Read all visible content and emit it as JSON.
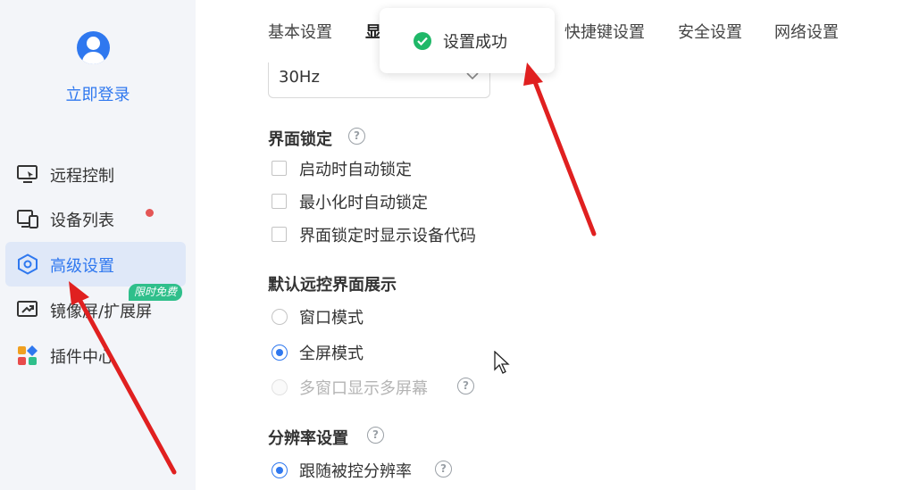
{
  "sidebar": {
    "login_label": "立即登录",
    "items": [
      {
        "label": "远程控制",
        "icon": "remote-desktop-icon"
      },
      {
        "label": "设备列表",
        "icon": "devices-icon"
      },
      {
        "label": "高级设置",
        "icon": "hexagon-settings-icon",
        "active": true
      },
      {
        "label": "镜像屏/扩展屏",
        "icon": "mirror-screen-icon"
      },
      {
        "label": "插件中心",
        "icon": "plugin-grid-icon"
      }
    ],
    "promo_badge": "限时免费"
  },
  "tabs": [
    "基本设置",
    "显",
    "快捷键设置",
    "安全设置",
    "网络设置"
  ],
  "refresh_select": {
    "value": "30Hz"
  },
  "lock_section": {
    "title": "界面锁定",
    "options": [
      "启动时自动锁定",
      "最小化时自动锁定",
      "界面锁定时显示设备代码"
    ]
  },
  "display_section": {
    "title": "默认远控界面展示",
    "options": [
      {
        "label": "窗口模式",
        "checked": false
      },
      {
        "label": "全屏模式",
        "checked": true
      },
      {
        "label": "多窗口显示多屏幕",
        "checked": false,
        "disabled": true
      }
    ]
  },
  "resolution_section": {
    "title": "分辨率设置",
    "options": [
      {
        "label": "跟随被控分辨率",
        "checked": true
      }
    ]
  },
  "toast": {
    "message": "设置成功"
  },
  "colors": {
    "accent": "#2f78ef",
    "success": "#1fb868",
    "annotation_arrow": "#e02020"
  }
}
